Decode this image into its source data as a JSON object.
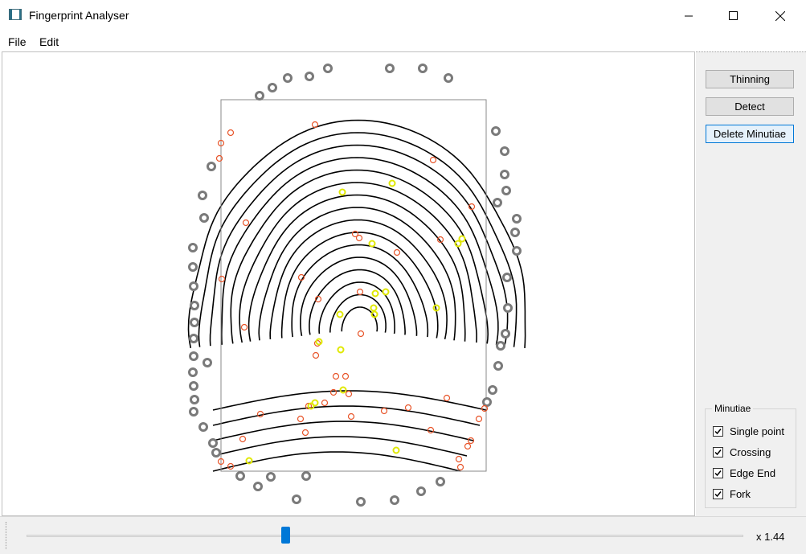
{
  "window": {
    "title": "Fingerprint Analyser",
    "controls": {
      "minimize": "minimize-icon",
      "maximize": "maximize-icon",
      "close": "close-icon"
    }
  },
  "menu": {
    "items": [
      "File",
      "Edit"
    ]
  },
  "panel": {
    "buttons": {
      "thinning": "Thinning",
      "detect": "Detect",
      "delete": "Delete Minutiae"
    },
    "minutiae": {
      "title": "Minutiae",
      "options": [
        {
          "label": "Single point",
          "checked": true
        },
        {
          "label": "Crossing",
          "checked": true
        },
        {
          "label": "Edge End",
          "checked": true
        },
        {
          "label": "Fork",
          "checked": true
        }
      ]
    }
  },
  "zoom": {
    "label": "x 1.44",
    "value": 1.44,
    "slider_fraction": 0.36
  },
  "colors": {
    "ridge": "#000000",
    "minutia_end": "#e8552a",
    "minutia_fork": "#e0e800",
    "boundary_point": "#7a7a7a",
    "roi_rect": "#8a8a8a"
  }
}
